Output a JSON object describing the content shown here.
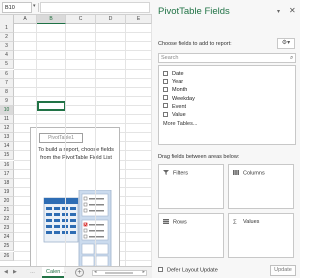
{
  "formula_bar": {
    "name_box": "B10"
  },
  "grid": {
    "columns": [
      "A",
      "B",
      "C",
      "D",
      "E"
    ],
    "rows": [
      "1",
      "2",
      "3",
      "4",
      "5",
      "6",
      "7",
      "8",
      "9",
      "10",
      "11",
      "12",
      "13",
      "14",
      "15",
      "16",
      "17",
      "18",
      "19",
      "20",
      "21",
      "22",
      "23",
      "24",
      "25",
      "26"
    ],
    "active_column": "B",
    "active_row": "10"
  },
  "pivot_placeholder": {
    "name": "PivotTable1",
    "message": "To build a report, choose fields from the PivotTable Field List"
  },
  "sheet_tabs": {
    "active_tab": "Calen",
    "more": "...",
    "add": "+"
  },
  "field_panel": {
    "title": "PivotTable Fields",
    "choose_label": "Choose fields to add to report:",
    "search_placeholder": "Search",
    "fields": [
      "Date",
      "Year",
      "Month",
      "Weekday",
      "Event",
      "Value"
    ],
    "more_tables": "More Tables...",
    "drag_label": "Drag fields between areas below:",
    "areas": {
      "filters": "Filters",
      "columns": "Columns",
      "rows": "Rows",
      "values": "Values"
    },
    "defer_label": "Defer Layout Update",
    "update_button": "Update"
  },
  "colors": {
    "accent": "#217346",
    "panel_bg": "#f7f7f7"
  }
}
